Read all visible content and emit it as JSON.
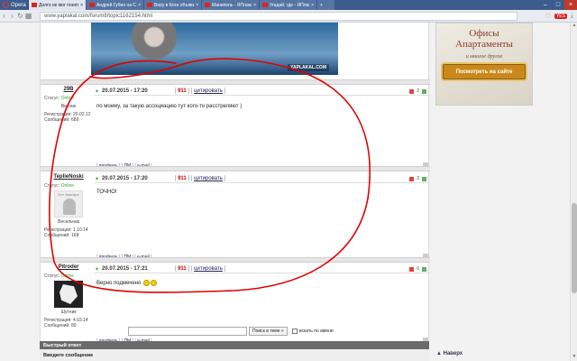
{
  "browser": {
    "menu_label": "Opera",
    "tabs": [
      {
        "title": "Долго не мог понять, кто",
        "active": true
      },
      {
        "title": "Андрей Губин на Сандо н",
        "active": false
      },
      {
        "title": "Веру в Бога объявили н",
        "active": false
      },
      {
        "title": "Манипель - ЯПлакалъ",
        "active": false
      },
      {
        "title": "Угадай, где - ЯПлакалъ",
        "active": false
      },
      {
        "title": "",
        "active": false
      }
    ],
    "url": "www.yaplakal.com/forum8/topic1162154.html",
    "badge": "YES"
  },
  "banner": {
    "stamp": "YAPLAKAL.COM"
  },
  "posts": [
    {
      "nick": "29B",
      "status_label": "Статус:",
      "status_value": "Online",
      "rank": "Весник",
      "reg_label": "Регистрация:",
      "reg_date": "20.02.12",
      "msgs_label": "Сообщений:",
      "msgs": "689",
      "date": "20.07.2015 - 17:20",
      "rating": "911",
      "quote": "цитировать",
      "rnum": "2",
      "text": "по моему, за такую ассоциацию тут кого-то расстреляют )"
    },
    {
      "nick": "TeplieNoski",
      "status_label": "Статус:",
      "status_value": "Online",
      "avatar_label": "Нет Аватара",
      "rank": "Весельчак",
      "reg_label": "Регистрация:",
      "reg_date": "1.10.14",
      "msgs_label": "Сообщений:",
      "msgs": "168",
      "date": "20.07.2015 - 17:20",
      "rating": "911",
      "quote": "цитировать",
      "rnum": "3",
      "text": "ТОЧНО!"
    },
    {
      "nick": "Pitroder",
      "status_label": "Статус:",
      "status_value": "Online",
      "rank": "Шутник",
      "reg_label": "Регистрация:",
      "reg_date": "4.03.14",
      "msgs_label": "Сообщений:",
      "msgs": "80",
      "date": "20.07.2015 - 17:21",
      "rating": "911",
      "quote": "цитировать",
      "rnum": "0",
      "text": "Верно подмечено"
    }
  ],
  "post_links": {
    "profile": "профиль",
    "pm": "ПМ",
    "email": "e-mail"
  },
  "search": {
    "button": "Поиск в теме »",
    "checkbox_label": "искать по имени"
  },
  "quick_reply": {
    "header": "Быстрый ответ",
    "prompt": "Введите сообщение"
  },
  "ad": {
    "line1": "Офисы",
    "line2": "Апартаменты",
    "tagline": "и многое другое",
    "button": "Посмотреть на сайте"
  },
  "back_to_top": "▲ Наверх",
  "colors": {
    "annotation": "#e00000",
    "accent": "#c9891a"
  }
}
